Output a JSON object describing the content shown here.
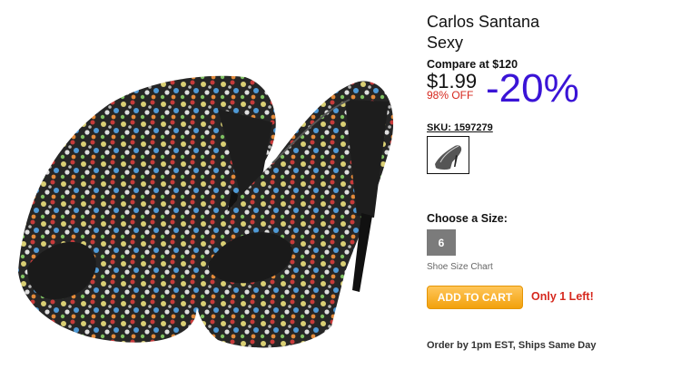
{
  "product": {
    "brand": "Carlos Santana",
    "model": "Sexy",
    "compare_label": "Compare at $120",
    "price": "$1.99",
    "off": "98% OFF",
    "discount": "-20%",
    "sku": "SKU: 1597279",
    "choose_size_label": "Choose a Size:",
    "size": "6",
    "size_chart_link": "Shoe Size Chart",
    "add_to_cart": "ADD TO CART",
    "stock_note": "Only 1 Left!",
    "shipping_note": "Order by 1pm EST, Ships Same Day"
  },
  "colors": {
    "discount": "#3a14d6",
    "sale_red": "#d6281e",
    "cart_button": "#f2a10c",
    "size_box": "#7b7b7b"
  }
}
